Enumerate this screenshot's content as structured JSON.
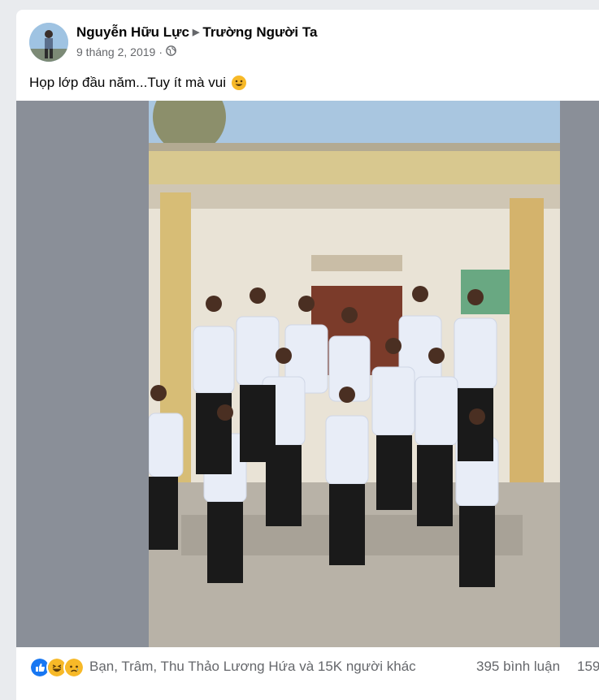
{
  "post": {
    "author": "Nguyễn Hữu Lực",
    "group": "Trường Người Ta",
    "date": "9 tháng 2, 2019",
    "separator_dot": "·",
    "caption": "Họp lớp đầu năm...Tuy ít mà vui",
    "caption_emoji": "grinning-face-emoji",
    "privacy_icon": "globe-icon"
  },
  "photo": {
    "description_icon": "group-photo-image"
  },
  "footer": {
    "reaction_icons": [
      "like-icon",
      "haha-icon",
      "sad-icon"
    ],
    "reaction_summary": "Bạn, Trâm, Thu Thảo Lương Hứa và 15K người khác",
    "comments": "395 bình luận",
    "shares": "159"
  },
  "colors": {
    "like_blue": "#1877f2",
    "emoji_yellow": "#f7b928",
    "secondary_text": "#65676b",
    "photo_side_gray": "#8a8f98"
  }
}
